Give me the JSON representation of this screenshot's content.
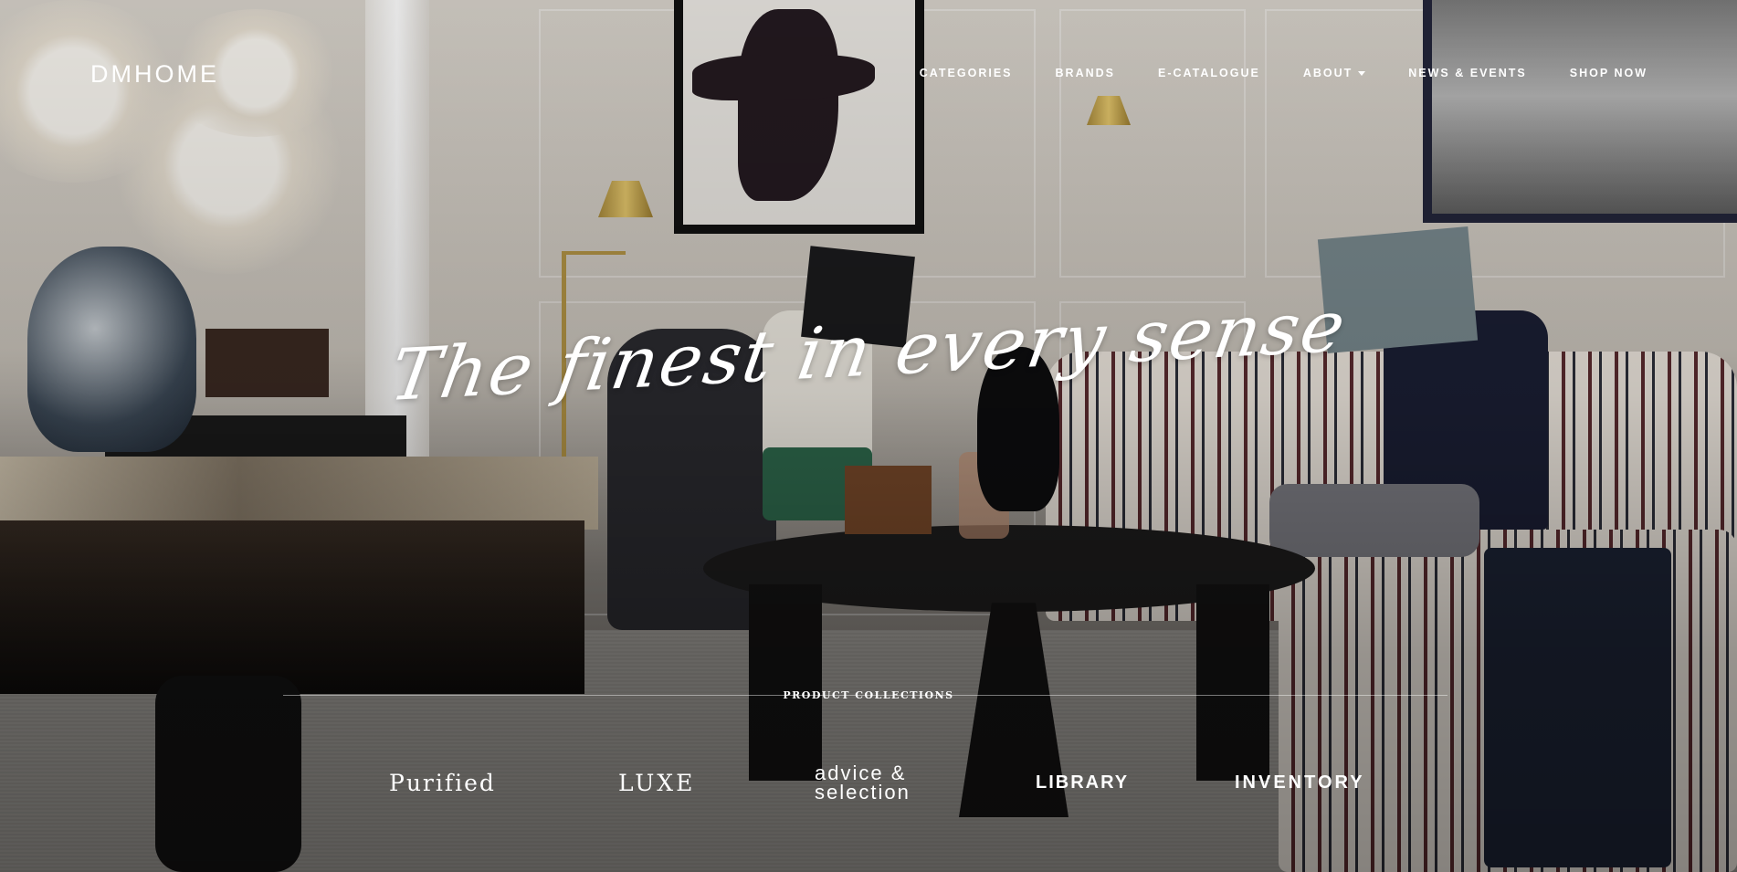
{
  "header": {
    "logo": "DMHOME",
    "nav": [
      {
        "label": "CATEGORIES"
      },
      {
        "label": "BRANDS"
      },
      {
        "label": "E-CATALOGUE"
      },
      {
        "label": "ABOUT",
        "dropdown": true
      },
      {
        "label": "NEWS & EVENTS"
      },
      {
        "label": "SHOP NOW"
      }
    ]
  },
  "hero": {
    "tagline": "The finest in every sense",
    "image": "living-room-with-people-reading-books"
  },
  "collections": {
    "label": "PRODUCT COLLECTIONS",
    "items": [
      {
        "label": "Purified"
      },
      {
        "label": "LUXE"
      },
      {
        "label_line1": "advice &",
        "label_line2": "selection"
      },
      {
        "label": "LIBRARY"
      },
      {
        "label": "INVENTORY"
      }
    ]
  },
  "colors": {
    "text": "#ffffff",
    "overlay": "rgba(0,0,0,0.35)"
  }
}
